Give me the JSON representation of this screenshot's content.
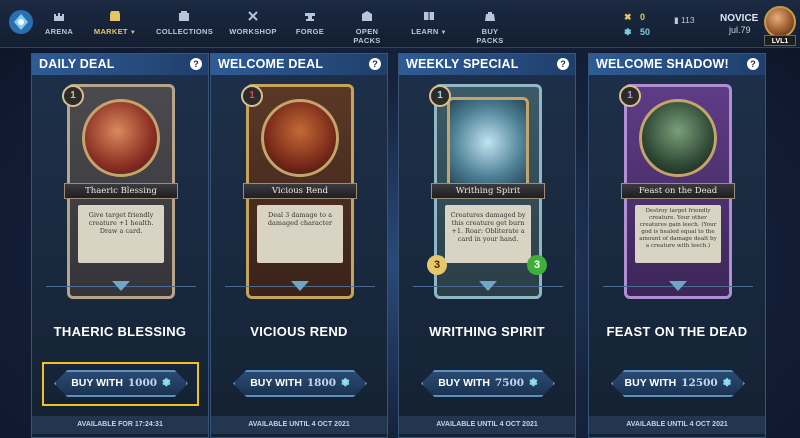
{
  "nav": {
    "items": [
      {
        "label": "ARENA",
        "icon": "castle-icon"
      },
      {
        "label": "MARKET",
        "icon": "shop-icon"
      },
      {
        "label": "COLLECTIONS",
        "icon": "collections-icon"
      },
      {
        "label": "WORKSHOP",
        "icon": "tools-icon"
      },
      {
        "label": "FORGE",
        "icon": "anvil-icon"
      },
      {
        "label": "OPEN PACKS",
        "icon": "pack-icon"
      },
      {
        "label": "LEARN",
        "icon": "book-icon"
      },
      {
        "label": "BUY PACKS",
        "icon": "bag-icon"
      }
    ],
    "active": "MARKET"
  },
  "resources": {
    "gold": "0",
    "gems": "50",
    "cards": "113"
  },
  "profile": {
    "rank": "NOVICE",
    "username": "jul.79",
    "level": "LVL1"
  },
  "deals": [
    {
      "header": "DAILY DEAL",
      "help": "?",
      "card_name": "Thaeric Blessing",
      "card_text": "Give target friendly creature +1 health. Draw a card.",
      "cost_badge": "1",
      "title": "THAERIC BLESSING",
      "buy_label": "BUY WITH",
      "price": "1000",
      "availability": "AVAILABLE FOR 17:24:31",
      "highlighted": true
    },
    {
      "header": "WELCOME DEAL",
      "help": "?",
      "card_name": "Vicious Rend",
      "card_text": "Deal 3 damage to a damaged character",
      "cost_badge": "1",
      "title": "VICIOUS REND",
      "buy_label": "BUY WITH",
      "price": "1800",
      "availability": "AVAILABLE UNTIL 4 OCT 2021",
      "highlighted": false
    },
    {
      "header": "WEEKLY SPECIAL",
      "help": "?",
      "card_name": "Writhing Spirit",
      "card_text": "Creatures damaged by this creature get burn +1. Roar: Obliterate a card in your hand.",
      "cost_badge": "1",
      "attack": "3",
      "health": "3",
      "title": "WRITHING SPIRIT",
      "buy_label": "BUY WITH",
      "price": "7500",
      "availability": "AVAILABLE UNTIL 4 OCT 2021",
      "highlighted": false
    },
    {
      "header": "WELCOME SHADOW!",
      "help": "?",
      "card_name": "Feast on the Dead",
      "card_text": "Destroy target friendly creature. Your other creatures gain leech. (Your god is healed equal to the amount of damage dealt by a creature with leech.)",
      "cost_badge": "1",
      "title": "FEAST ON THE DEAD",
      "buy_label": "BUY WITH",
      "price": "12500",
      "availability": "AVAILABLE UNTIL 4 OCT 2021",
      "highlighted": false
    }
  ],
  "colors": {
    "accent": "#f2c02b",
    "gem": "#8ee0f0"
  }
}
